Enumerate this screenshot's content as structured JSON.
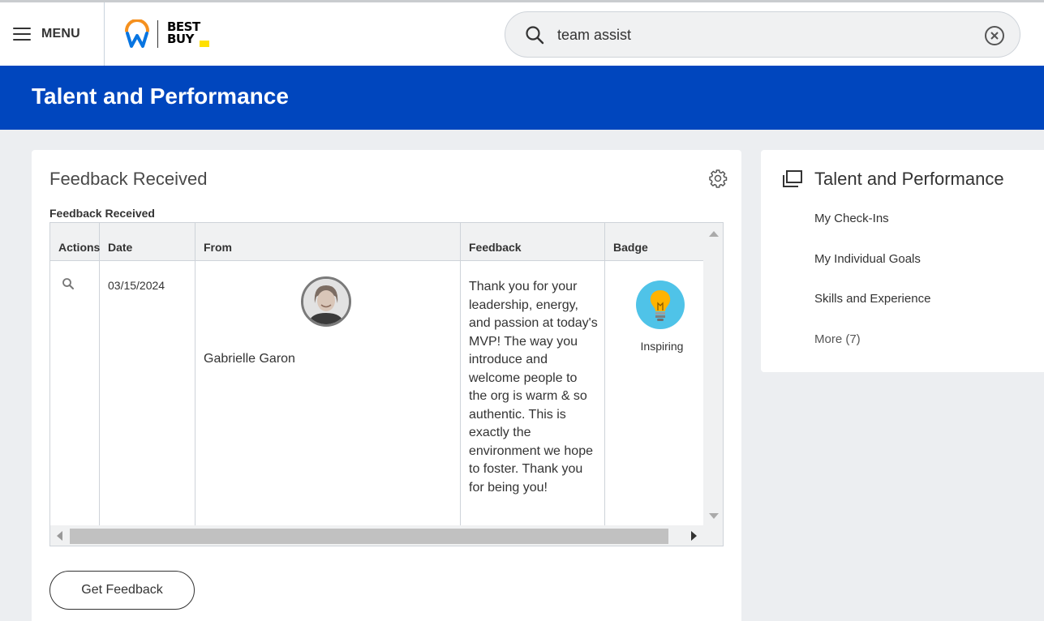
{
  "topbar": {
    "menu_label": "MENU",
    "brand_logo_text": [
      "BEST",
      "BUY"
    ],
    "search_value": "team assist"
  },
  "page": {
    "title": "Talent and Performance"
  },
  "feedback_card": {
    "title": "Feedback Received",
    "grid_title": "Feedback Received",
    "columns": [
      "Actions",
      "Date",
      "From",
      "Feedback",
      "Badge"
    ],
    "rows": [
      {
        "date": "03/15/2024",
        "from": "Gabrielle Garon",
        "feedback": "Thank you for your leadership, energy, and passion at today's MVP! The way you introduce and welcome people to the org is warm & so authentic. This is exactly the environment we hope to foster. Thank you for being you!",
        "badge": "Inspiring"
      }
    ],
    "button_label": "Get Feedback"
  },
  "side_card": {
    "title": "Talent and Performance",
    "links": [
      "My Check-Ins",
      "My Individual Goals",
      "Skills and Experience",
      "More (7)"
    ]
  },
  "colors": {
    "brand_blue": "#0046be",
    "logo_orange": "#f5901e",
    "logo_blue": "#0875e1",
    "bestbuy_yellow": "#ffe000",
    "badge_circle": "#4fc3e8",
    "badge_bulb": "#ffb300"
  },
  "icons": [
    "hamburger-icon",
    "workday-logo-icon",
    "search-icon",
    "clear-icon",
    "gear-icon",
    "magnifier-icon",
    "avatar",
    "lightbulb-badge-icon",
    "worklet-icon"
  ]
}
